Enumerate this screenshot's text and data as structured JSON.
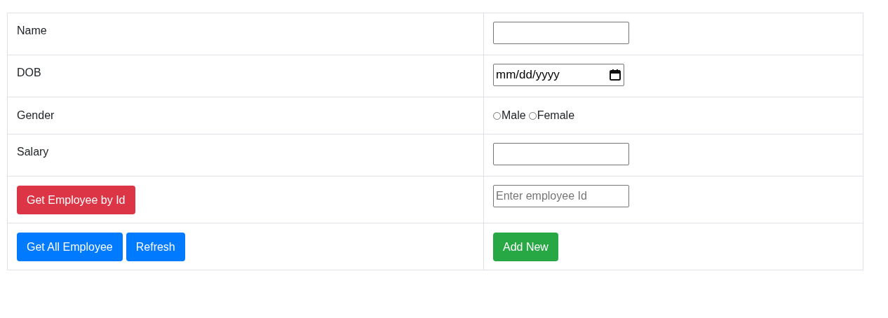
{
  "form": {
    "rows": [
      {
        "kind": "text",
        "label": "Name"
      },
      {
        "kind": "date",
        "label": "DOB",
        "display": "mm/dd/yyyy"
      },
      {
        "kind": "radio",
        "label": "Gender",
        "options": [
          {
            "label": "Male",
            "checked": false
          },
          {
            "label": "Female",
            "checked": false
          }
        ]
      },
      {
        "kind": "text",
        "label": "Salary"
      },
      {
        "kind": "lookup",
        "buttons": [
          {
            "label": "Get Employee by Id",
            "color": "#dc3545"
          }
        ],
        "field": {
          "placeholder": "Enter employee Id"
        }
      },
      {
        "kind": "actions",
        "buttons": [
          {
            "label": "Get All Employee",
            "color": "#007bff"
          },
          {
            "label": "Refresh",
            "color": "#007bff"
          }
        ],
        "right_buttons": [
          {
            "label": "Add New",
            "color": "#28a745"
          }
        ]
      }
    ]
  }
}
